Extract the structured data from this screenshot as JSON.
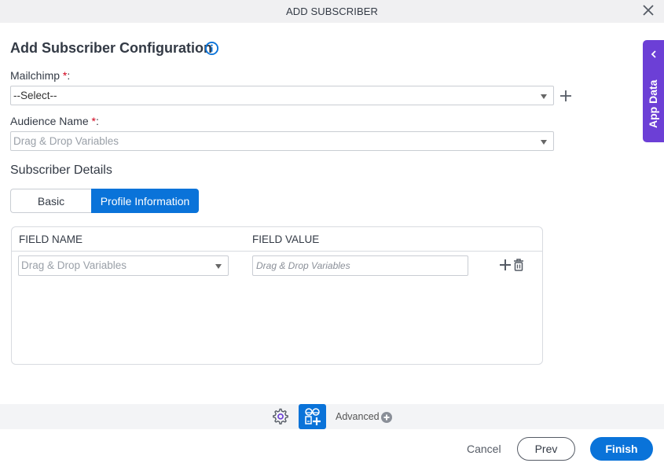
{
  "window": {
    "title": "ADD SUBSCRIBER"
  },
  "heading": "Add Subscriber Configuration",
  "form": {
    "mailchimp": {
      "label": "Mailchimp",
      "required_mark": "*",
      "colon": ":",
      "value": "--Select--"
    },
    "audience": {
      "label": "Audience Name",
      "required_mark": "*",
      "colon": ":",
      "placeholder": "Drag & Drop Variables"
    }
  },
  "subscriber_details": {
    "title": "Subscriber Details",
    "tabs": [
      {
        "label": "Basic",
        "active": false
      },
      {
        "label": "Profile Information",
        "active": true
      }
    ],
    "grid": {
      "columns": [
        "FIELD NAME",
        "FIELD VALUE"
      ],
      "rows": [
        {
          "field_name_placeholder": "Drag & Drop Variables",
          "field_value_placeholder": "Drag & Drop Variables"
        }
      ]
    }
  },
  "toolbar": {
    "advanced_label": "Advanced"
  },
  "footer": {
    "cancel": "Cancel",
    "prev": "Prev",
    "finish": "Finish"
  },
  "side_panel": {
    "label": "App Data"
  },
  "colors": {
    "primary": "#0a73d9",
    "side_panel": "#6c3fd6",
    "required": "#d0021b"
  }
}
